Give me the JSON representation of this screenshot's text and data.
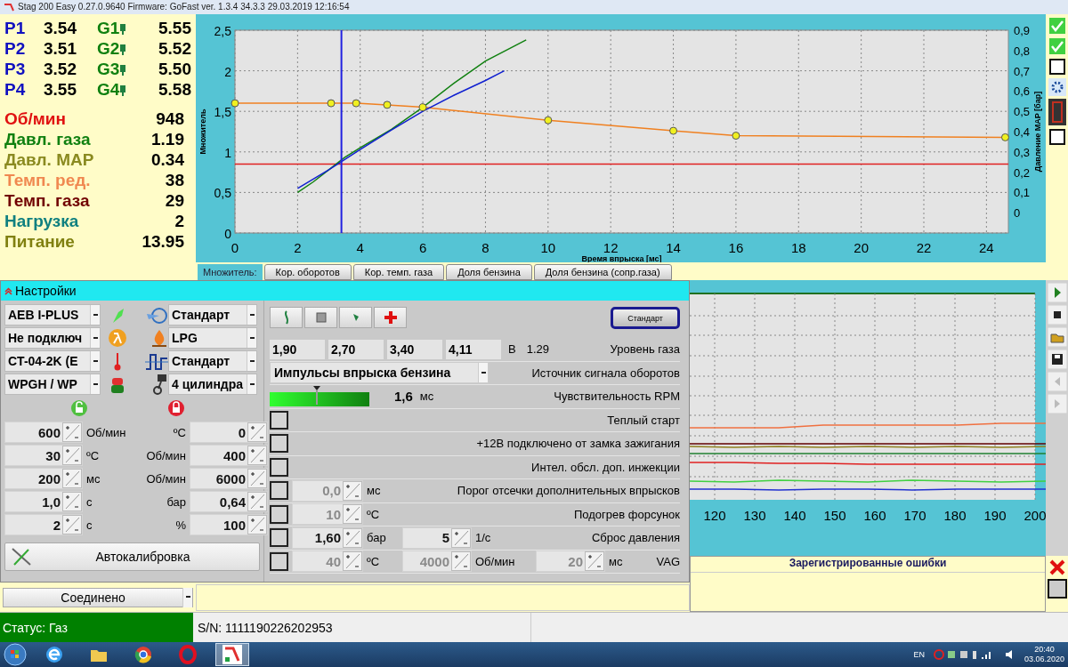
{
  "window": {
    "title": "Stag 200 Easy 0.27.0.9640 Firmware: GoFast  ver. 1.3.4  34.3.3   29.03.2019 12:16:54"
  },
  "injectors": [
    {
      "p_label": "P1",
      "p_value": "3.54",
      "g_label": "G1",
      "g_value": "5.55"
    },
    {
      "p_label": "P2",
      "p_value": "3.51",
      "g_label": "G2",
      "g_value": "5.52"
    },
    {
      "p_label": "P3",
      "p_value": "3.52",
      "g_label": "G3",
      "g_value": "5.50"
    },
    {
      "p_label": "P4",
      "p_value": "3.55",
      "g_label": "G4",
      "g_value": "5.58"
    }
  ],
  "readings": [
    {
      "label": "Об/мин",
      "value": "948",
      "color": "#e01010"
    },
    {
      "label": "Давл. газа",
      "value": "1.19",
      "color": "#108010"
    },
    {
      "label": "Давл. MAP",
      "value": "0.34",
      "color": "#8a8a20"
    },
    {
      "label": "Темп. ред.",
      "value": "38",
      "color": "#f08850"
    },
    {
      "label": "Темп. газа",
      "value": "29",
      "color": "#700000"
    },
    {
      "label": "Нагрузка",
      "value": "2",
      "color": "#108080"
    },
    {
      "label": "Питание",
      "value": "13.95",
      "color": "#808010"
    }
  ],
  "main_chart": {
    "chart_data": {
      "type": "line",
      "grid": true,
      "xlabel": "Время впрыска [мс]",
      "ylabel": "Множитель",
      "xlim": [
        0,
        24.7
      ],
      "ylim": [
        0,
        2.5
      ],
      "xticks": [
        0,
        2,
        4,
        6,
        8,
        10,
        12,
        14,
        16,
        18,
        20,
        22,
        24
      ],
      "yticks": [
        {
          "value": 0,
          "label": "0"
        },
        {
          "value": 0.5,
          "label": "0,5"
        },
        {
          "value": 1,
          "label": "1"
        },
        {
          "value": 1.5,
          "label": "1,5"
        },
        {
          "value": 2,
          "label": "2"
        },
        {
          "value": 2.5,
          "label": "2,5"
        }
      ],
      "series": [
        {
          "color": "#f08020",
          "marker": "o",
          "x": [
            0,
            3.07,
            3.87,
            4.86,
            6,
            10,
            14,
            16,
            24.6
          ],
          "values": [
            1.6,
            1.6,
            1.6,
            1.58,
            1.55,
            1.39,
            1.26,
            1.2,
            1.18
          ]
        },
        {
          "color": "#e02020",
          "x": [
            0,
            24.7
          ],
          "values": [
            0.85,
            0.85
          ]
        },
        {
          "color": "#108010",
          "x": [
            2,
            2.5,
            3,
            3.5,
            4,
            5,
            6,
            7,
            8,
            9.3
          ],
          "values": [
            0.5,
            0.63,
            0.78,
            0.93,
            1.05,
            1.28,
            1.55,
            1.85,
            2.12,
            2.38
          ]
        },
        {
          "color": "#1020d0",
          "x": [
            2,
            3,
            4,
            5,
            6,
            7,
            8,
            8.6
          ],
          "values": [
            0.55,
            0.78,
            1.03,
            1.27,
            1.5,
            1.7,
            1.88,
            2.0
          ]
        }
      ],
      "ref_lines": [
        {
          "axis": "x",
          "value": 3.4,
          "color": "#2020e0"
        }
      ]
    },
    "right_axis": {
      "label": "Давление MAP [бар]",
      "ticks": [
        "0,9",
        "0,8",
        "0,7",
        "0,6",
        "0,5",
        "0,4",
        "0,3",
        "0,2",
        "0,1",
        "0"
      ]
    }
  },
  "top_toolbar": [
    {
      "kind": "check"
    },
    {
      "kind": "check"
    },
    {
      "kind": "frame"
    },
    {
      "kind": "gear"
    },
    {
      "kind": "display"
    },
    {
      "kind": "frame"
    }
  ],
  "tabs_caption": "Множитель:",
  "tabs": [
    {
      "label": "Кор. оборотов",
      "selected": false
    },
    {
      "label": "Кор. темп. газа",
      "selected": false
    },
    {
      "label": "Доля бензина",
      "selected": false
    },
    {
      "label": "Доля бензина (сопр.газа)",
      "selected": false
    }
  ],
  "settings": {
    "title": "Настройки",
    "selects_left": [
      {
        "value": "AEB I-PLUS",
        "kind": "injector"
      },
      {
        "value": "Не подключ",
        "kind": "lambda"
      },
      {
        "value": "CT-04-2K (E",
        "kind": "thermometer"
      },
      {
        "value": "WPGH / WP",
        "kind": "tank"
      }
    ],
    "selects_right": [
      {
        "value": "Стандарт",
        "kind": "fan"
      },
      {
        "value": "LPG",
        "kind": "flame"
      },
      {
        "value": "Стандарт",
        "kind": "pulse"
      },
      {
        "value": "4 цилиндра",
        "kind": "piston"
      }
    ],
    "thresholds_left": [
      {
        "value": "600",
        "unit": "Об/мин"
      },
      {
        "value": "30",
        "unit": "ºC"
      },
      {
        "value": "200",
        "unit": "мс"
      },
      {
        "value": "1,0",
        "unit": "с"
      },
      {
        "value": "2",
        "unit": "с"
      }
    ],
    "thresholds_right": [
      {
        "unit": "ºC",
        "value": "0"
      },
      {
        "unit": "Об/мин",
        "value": "400"
      },
      {
        "unit": "Об/мин",
        "value": "6000"
      },
      {
        "unit": "бар",
        "value": "0,64"
      },
      {
        "unit": "%",
        "value": "100"
      }
    ],
    "autocal_button": "Автокалибровка",
    "tool_buttons": [
      {
        "kind": "squiggle"
      },
      {
        "kind": "square"
      },
      {
        "kind": "figure"
      },
      {
        "kind": "cross"
      }
    ],
    "standard_button": "Стандарт",
    "gas_level": {
      "values": [
        "1,90",
        "2,70",
        "3,40",
        "4,11"
      ],
      "unit": "В",
      "reading": "1.29",
      "label": "Уровень газа"
    },
    "rpm_source": {
      "value": "Импульсы впрыска бензина",
      "label": "Источник сигнала оборотов"
    },
    "rpm_sensitivity": {
      "level": 0.47,
      "value": "1,6",
      "unit": "мс",
      "label": "Чувствительность RPM"
    },
    "options": [
      {
        "label": "Теплый старт",
        "checked": false
      },
      {
        "label": "+12В подключено от замка зажигания",
        "checked": false
      },
      {
        "label": "Интел. обсл. доп. инжекции",
        "checked": false
      },
      {
        "label": "Порог отсечки дополнительных впрысков",
        "checked": false,
        "fields": [
          {
            "value": "0,0",
            "unit": "мс",
            "disabled": true
          }
        ]
      },
      {
        "label": "Подогрев форсунок",
        "checked": false,
        "fields": [
          {
            "value": "10",
            "unit": "ºC",
            "disabled": true
          }
        ]
      },
      {
        "label": "Сброс давления",
        "checked": false,
        "fields": [
          {
            "value": "1,60",
            "unit": "бар",
            "disabled": false
          },
          {
            "value": "5",
            "unit": "1/с",
            "disabled": false
          }
        ]
      },
      {
        "label": "VAG",
        "checked": false,
        "fields": [
          {
            "value": "40",
            "unit": "ºC",
            "disabled": true
          },
          {
            "value": "4000",
            "unit": "Об/мин",
            "disabled": true
          },
          {
            "value": "20",
            "unit": "мс",
            "disabled": true
          }
        ]
      }
    ]
  },
  "trace_chart": {
    "x_labels": [
      "120",
      "130",
      "140",
      "150",
      "160",
      "170",
      "180",
      "190",
      "200"
    ]
  },
  "trace_toolbar": [
    {
      "kind": "play",
      "disabled": false
    },
    {
      "kind": "stop",
      "disabled": false
    },
    {
      "kind": "folder",
      "disabled": false
    },
    {
      "kind": "save",
      "disabled": false
    },
    {
      "kind": "left",
      "disabled": true
    },
    {
      "kind": "right",
      "disabled": true
    }
  ],
  "errors": {
    "title": "Зарегистрированные ошибки"
  },
  "connection": {
    "value": "Соединено"
  },
  "status": {
    "state": "Статус: Газ",
    "serial": "S/N: 1111190226202953"
  },
  "taskbar": {
    "apps": [
      {
        "kind": "ie",
        "selected": false
      },
      {
        "kind": "folder",
        "selected": false
      },
      {
        "kind": "chrome",
        "selected": false
      },
      {
        "kind": "opera",
        "selected": false
      },
      {
        "kind": "app",
        "selected": true
      }
    ],
    "lang": "EN",
    "time": "20:40",
    "date": "03.06.2020"
  }
}
